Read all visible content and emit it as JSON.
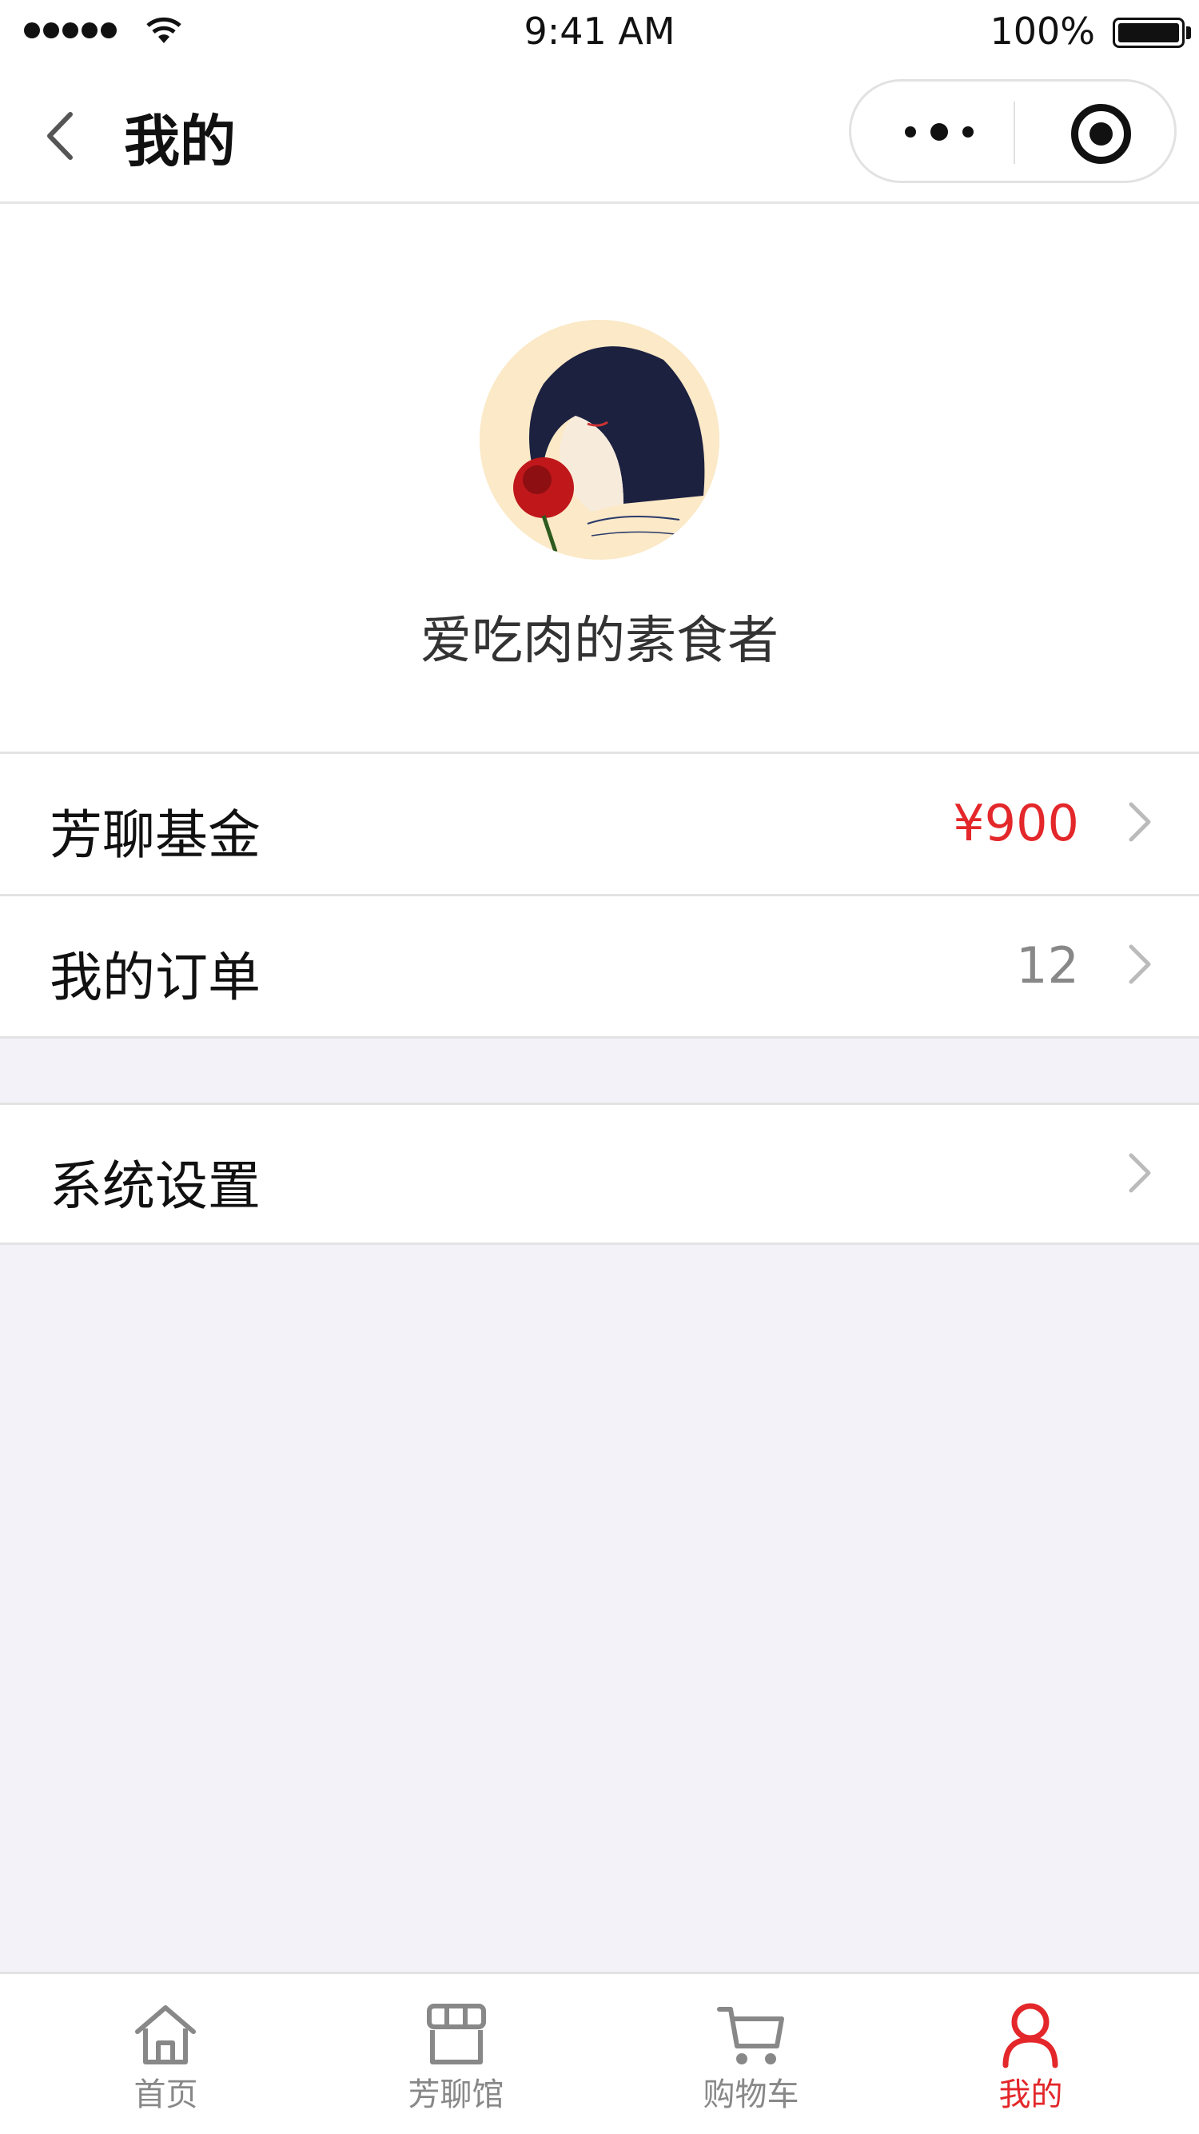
{
  "status_bar": {
    "time": "9:41 AM",
    "battery": "100%"
  },
  "nav": {
    "title": "我的"
  },
  "profile": {
    "username": "爱吃肉的素食者"
  },
  "menu": [
    {
      "label": "芳聊基金",
      "value": "¥900",
      "value_color": "#e3272a"
    },
    {
      "label": "我的订单",
      "value": "12",
      "value_color": "#888888"
    },
    {
      "label": "系统设置",
      "value": ""
    }
  ],
  "tabs": [
    {
      "label": "首页",
      "icon": "home-icon"
    },
    {
      "label": "芳聊馆",
      "icon": "store-icon"
    },
    {
      "label": "购物车",
      "icon": "cart-icon"
    },
    {
      "label": "我的",
      "icon": "user-icon",
      "active": true
    }
  ],
  "colors": {
    "accent": "#e3272a",
    "background": "#f3f2f8"
  }
}
